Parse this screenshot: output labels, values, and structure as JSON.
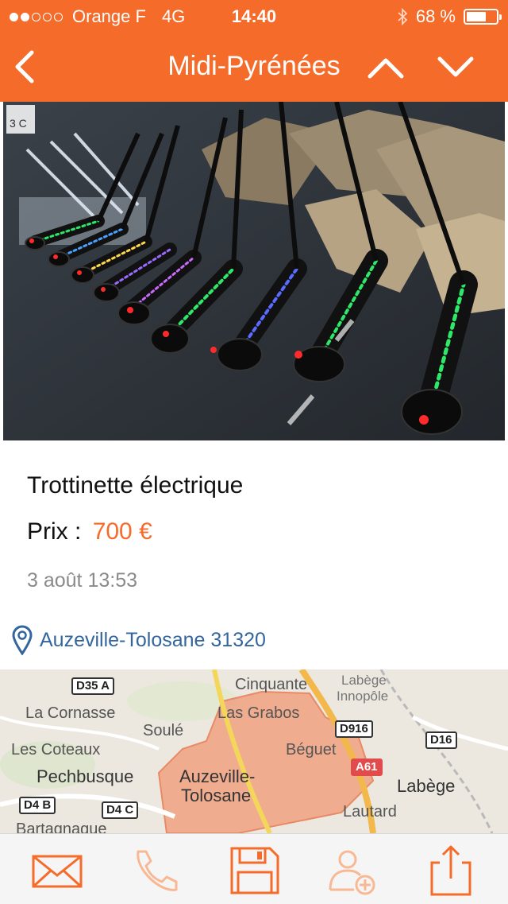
{
  "status_bar": {
    "carrier": "Orange F",
    "network": "4G",
    "time": "14:40",
    "battery": "68 %",
    "battery_level": 0.68,
    "signal_bars": 2
  },
  "nav": {
    "title": "Midi-Pyrénées",
    "back_icon": "chevron-left-icon",
    "prev_icon": "chevron-up-icon",
    "next_icon": "chevron-down-icon"
  },
  "listing": {
    "title": "Trottinette électrique",
    "price_label": "Prix :",
    "price_value": "700 €",
    "date": "3 août 13:53",
    "location": "Auzeville-Tolosane 31320"
  },
  "map": {
    "places": [
      "Cinquante",
      "Labège",
      "Innopôle",
      "La Cornasse",
      "Las Grabos",
      "Soulé",
      "Les Coteaux",
      "Béguet",
      "Pechbusque",
      "Auzeville-",
      "Tolosane",
      "Labège",
      "Lautard",
      "Bartagnague"
    ],
    "roads": [
      "D35 A",
      "D916",
      "D16",
      "A61",
      "D4 B",
      "D4 C"
    ]
  },
  "photo_badge": "3 C",
  "toolbar": {
    "items": [
      "mail-icon",
      "phone-icon",
      "save-icon",
      "add-contact-icon",
      "share-icon"
    ]
  },
  "colors": {
    "accent": "#f56b2a",
    "link": "#33659e",
    "date": "#8a8a8a"
  }
}
